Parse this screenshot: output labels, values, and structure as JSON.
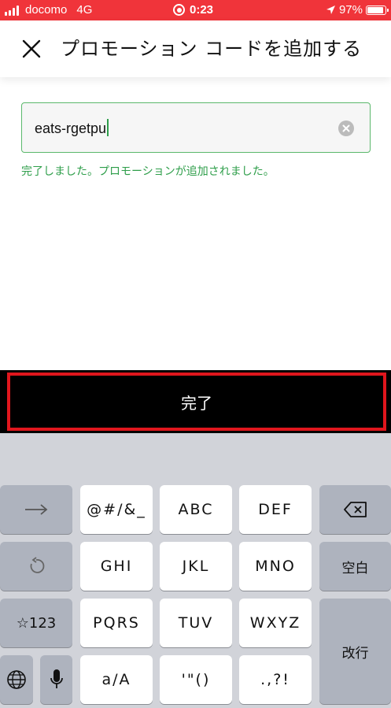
{
  "status_bar": {
    "carrier": "docomo",
    "network": "4G",
    "time": "0:23",
    "battery": "97%",
    "battery_level": 0.97
  },
  "header": {
    "title": "プロモーション コードを追加する"
  },
  "promo": {
    "value": "eats-rgetpu",
    "success_message": "完了しました。プロモーションが追加されました。"
  },
  "done_button": {
    "label": "完了"
  },
  "keyboard": {
    "row1": [
      "@#/&_",
      "ABC",
      "DEF"
    ],
    "row2": [
      "GHI",
      "JKL",
      "MNO"
    ],
    "row3": [
      "PQRS",
      "TUV",
      "WXYZ"
    ],
    "row4": [
      "a/A",
      "'\"()",
      ".,?!"
    ],
    "space_label": "空白",
    "number_label": "☆123",
    "return_label": "改行"
  },
  "colors": {
    "status_bar": "#f0343a",
    "accent_green": "#2e9e4a",
    "highlight_red": "#e0161d"
  }
}
